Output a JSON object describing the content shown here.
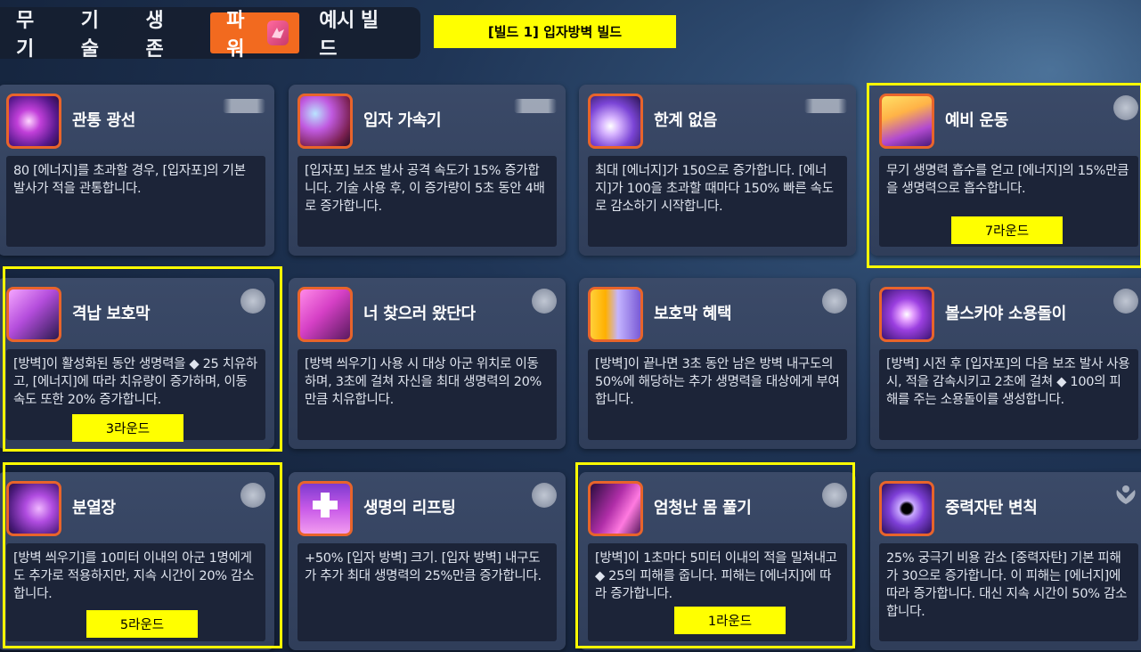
{
  "nav": {
    "tabs": [
      {
        "label": "무기"
      },
      {
        "label": "기술"
      },
      {
        "label": "생존"
      },
      {
        "label": "파워"
      },
      {
        "label": "예시 빌드"
      }
    ],
    "active_tab": "파워"
  },
  "build_banner": "[빌드 1] 입자방벽 빌드",
  "cards": [
    {
      "title": "관통 광선",
      "desc": "80 [에너지]를 초과할 경우, [입자포]의 기본 발사가 적을 관통합니다.",
      "badge": "gun"
    },
    {
      "title": "입자 가속기",
      "desc": "[입자포] 보조 발사 공격 속도가 15% 증가합니다. 기술 사용 후, 이 증가량이 5초 동안 4배로 증가합니다.",
      "badge": "gun"
    },
    {
      "title": "한계 없음",
      "desc": "최대 [에너지]가 150으로 증가합니다. [에너지]가 100을 초과할 때마다 150% 빠른 속도로 감소하기 시작합니다.",
      "badge": "gun"
    },
    {
      "title": "예비 운동",
      "desc": "무기 생명력 흡수를 얻고 [에너지]의 15%만큼을 생명력으로 흡수합니다.",
      "badge": "orb",
      "round": "7라운드"
    },
    {
      "title": "격납 보호막",
      "desc": "[방벽]이 활성화된 동안 생명력을 ◆ 25 치유하고, [에너지]에 따라 치유량이 증가하며, 이동 속도 또한 20% 증가합니다.",
      "badge": "orb",
      "round": "3라운드"
    },
    {
      "title": "너 찾으러 왔단다",
      "desc": "[방벽 씌우기] 사용 시 대상 아군 위치로 이동하며, 3초에 걸쳐 자신을 최대 생명력의 20%만큼 치유합니다.",
      "badge": "orb"
    },
    {
      "title": "보호막 혜택",
      "desc": "[방벽]이 끝나면 3초 동안 남은 방벽 내구도의 50%에 해당하는 추가 생명력을 대상에게 부여합니다.",
      "badge": "orb"
    },
    {
      "title": "볼스카야 소용돌이",
      "desc": "[방벽] 시전 후 [입자포]의 다음 보조 발사 사용 시, 적을 감속시키고 2초에 걸쳐 ◆ 100의 피해를 주는 소용돌이를 생성합니다.",
      "badge": "orb"
    },
    {
      "title": "분열장",
      "desc": "[방벽 씌우기]를 10미터 이내의 아군 1명에게도 추가로 적용하지만, 지속 시간이 20% 감소합니다.",
      "badge": "orb",
      "round": "5라운드"
    },
    {
      "title": "생명의 리프팅",
      "desc": "+50% [입자 방벽] 크기. [입자 방벽] 내구도가 추가 최대 생명력의 25%만큼 증가합니다.",
      "badge": "orb"
    },
    {
      "title": "엄청난 몸 풀기",
      "desc": "[방벽]이 1초마다 5미터 이내의 적을 밀쳐내고 ◆ 25의 피해를 줍니다. 피해는 [에너지]에 따라 증가합니다.",
      "badge": "orb",
      "round": "1라운드"
    },
    {
      "title": "중력자탄 변칙",
      "desc": "25% 궁극기 비용 감소 [중력자탄] 기본 피해가 30으로 증가합니다. 이 피해는 [에너지]에 따라 증가합니다. 대신 지속 시간이 50% 감소합니다.",
      "badge": "flower"
    }
  ],
  "colors": {
    "accent": "#f26a1f",
    "highlight_yellow": "#ffff00",
    "card_bg": "#36445f",
    "desc_bg": "#1c2438"
  }
}
